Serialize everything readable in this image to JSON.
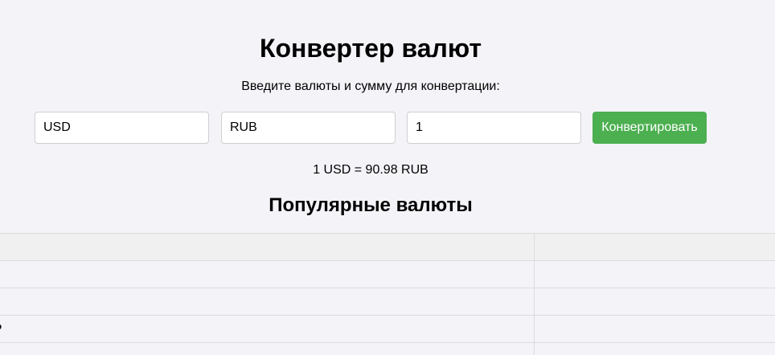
{
  "header": {
    "title": "Конвертер валют",
    "subtitle": "Введите валюты и сумму для конвертации:"
  },
  "form": {
    "from_value": "USD",
    "to_value": "RUB",
    "amount_value": "1",
    "convert_label": "Конвертировать"
  },
  "result": {
    "text": "1 USD = 90.98 RUB"
  },
  "popular": {
    "title": "Популярные валюты",
    "rows": [
      {
        "col1": "",
        "col2": ""
      },
      {
        "col1": "",
        "col2": ""
      },
      {
        "col1": "₽",
        "col2": ""
      }
    ]
  },
  "colors": {
    "background": "#f4f3f8",
    "button": "#4caf50",
    "table_header": "#f0f0f0"
  }
}
